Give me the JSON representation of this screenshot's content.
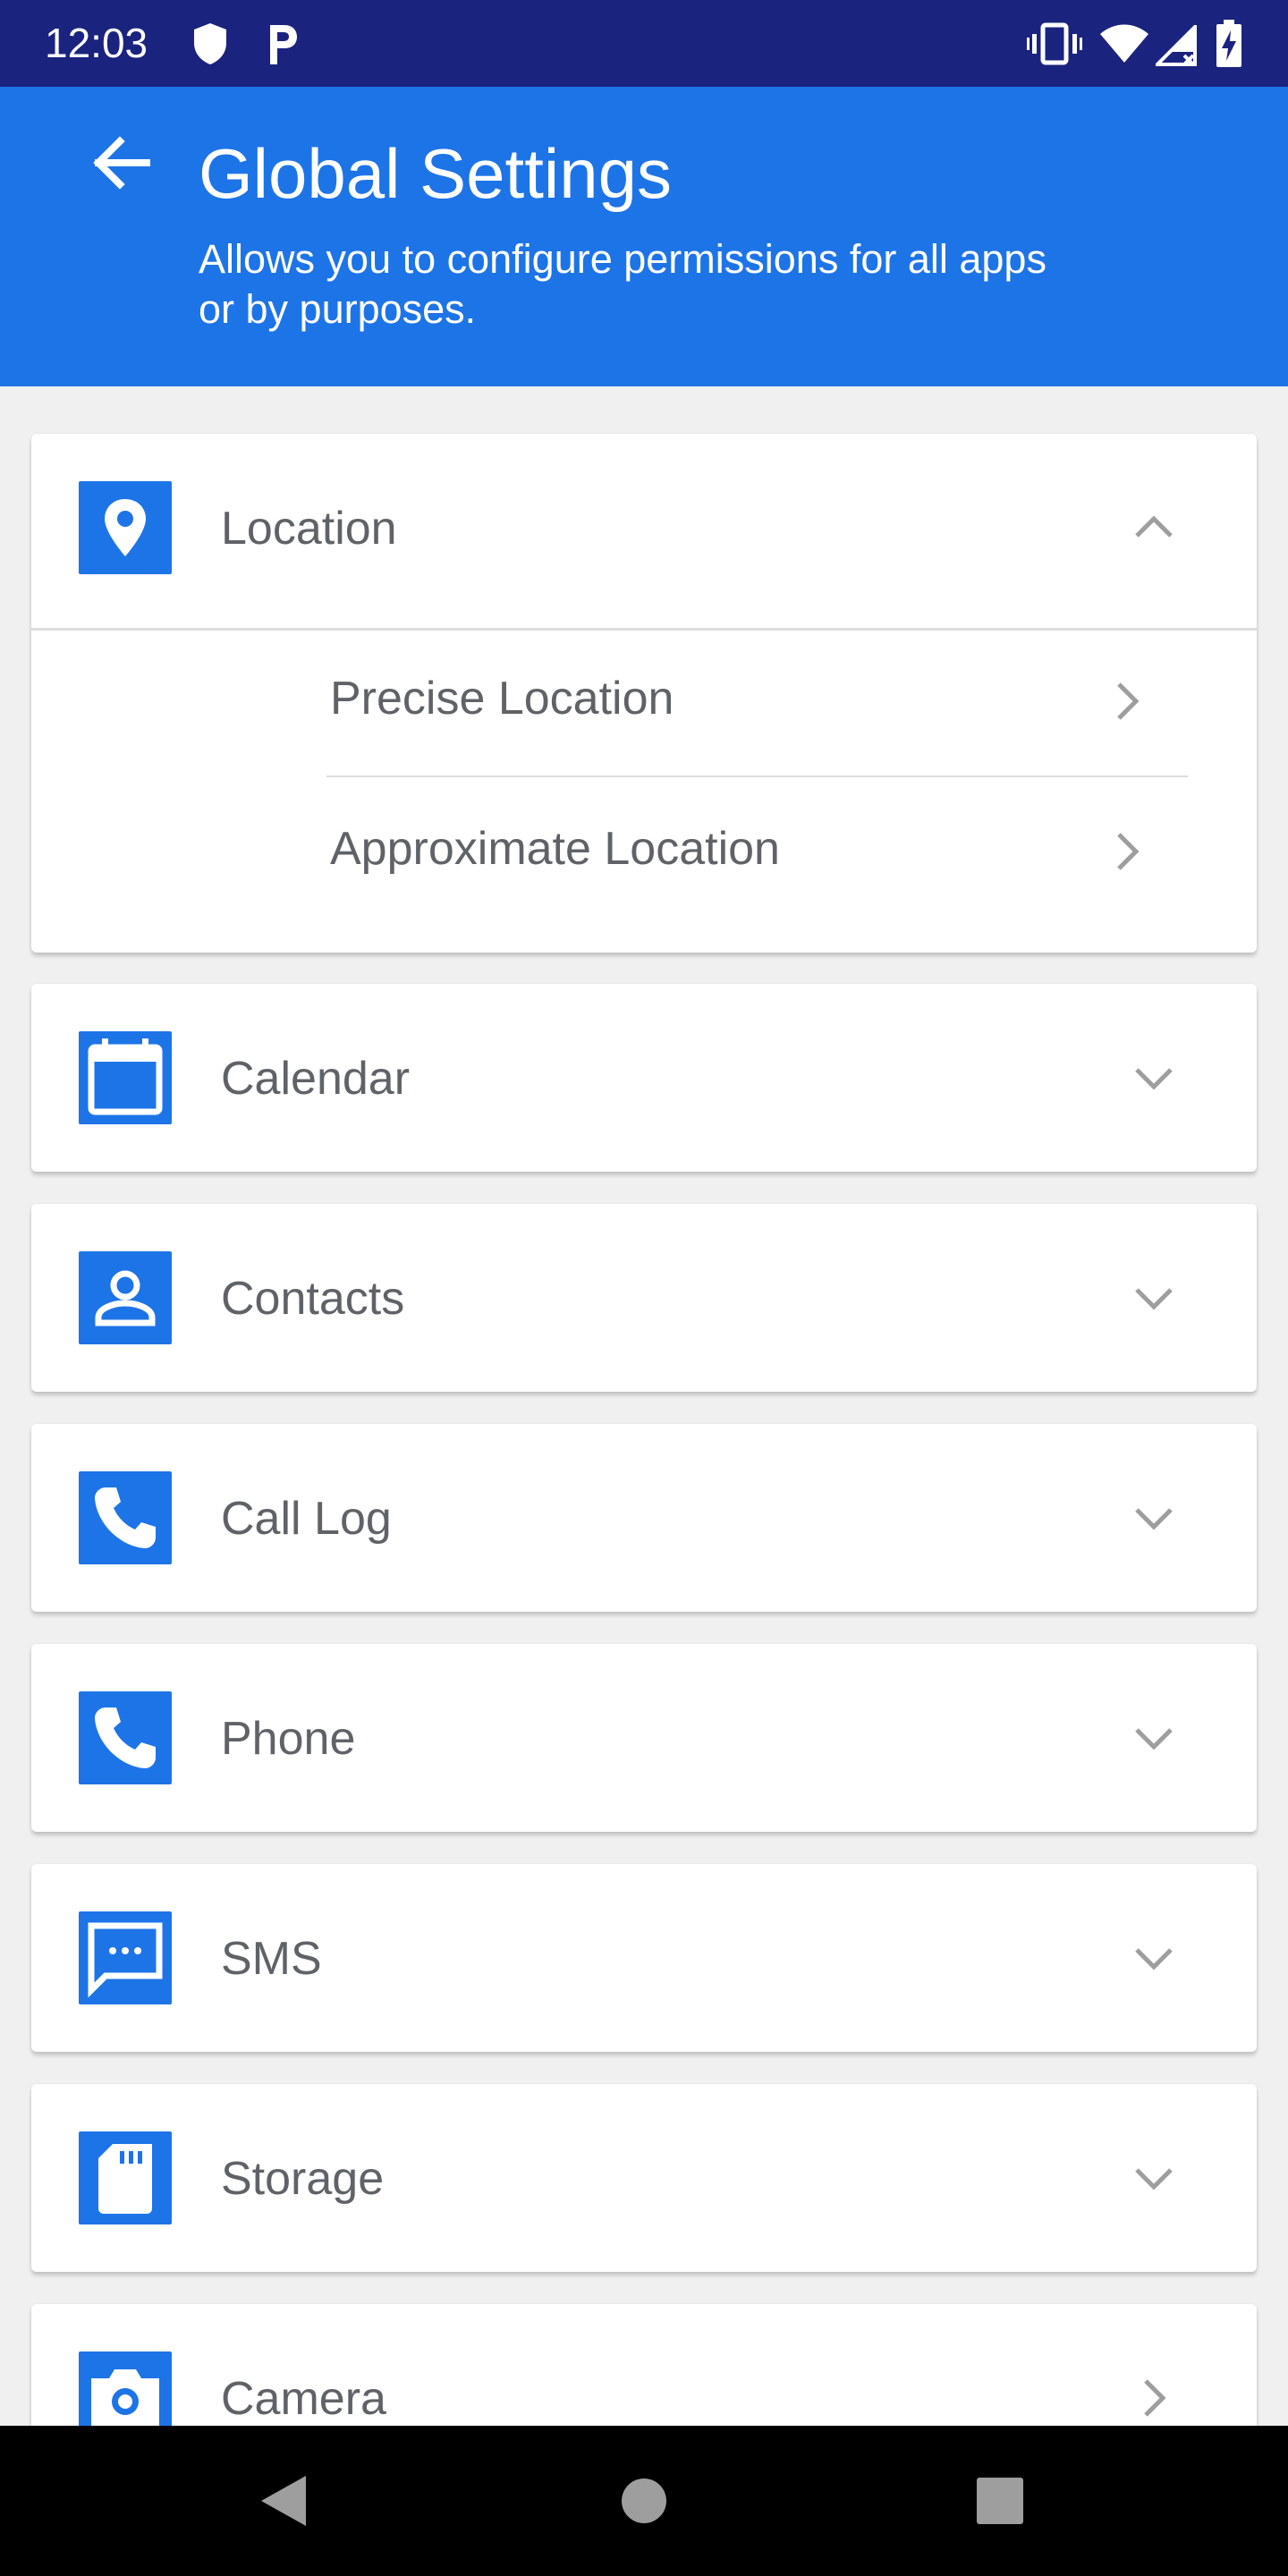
{
  "status_bar": {
    "time": "12:03",
    "left_icons": [
      "shield-icon",
      "parking-icon"
    ],
    "right_icons": [
      "vibrate-icon",
      "wifi-icon",
      "signal-icon",
      "battery-charging-icon"
    ],
    "background": "#1a237e"
  },
  "app_bar": {
    "title": "Global Settings",
    "subtitle": "Allows you to configure permissions for all apps or by purposes.",
    "back_icon": "arrow-left-icon",
    "background": "#1d74e7"
  },
  "permissions": [
    {
      "label": "Location",
      "icon": "location-pin-icon",
      "expanded": true,
      "children": [
        {
          "label": "Precise Location"
        },
        {
          "label": "Approximate Location"
        }
      ]
    },
    {
      "label": "Calendar",
      "icon": "calendar-icon",
      "expanded": false
    },
    {
      "label": "Contacts",
      "icon": "contact-icon",
      "expanded": false
    },
    {
      "label": "Call Log",
      "icon": "phone-icon",
      "expanded": false
    },
    {
      "label": "Phone",
      "icon": "phone-icon",
      "expanded": false
    },
    {
      "label": "SMS",
      "icon": "message-icon",
      "expanded": false
    },
    {
      "label": "Storage",
      "icon": "sd-card-icon",
      "expanded": false
    },
    {
      "label": "Camera",
      "icon": "camera-icon",
      "expanded": false
    }
  ],
  "colors": {
    "accent": "#1d74e7",
    "label_text": "#5f6368",
    "chevron": "#9e9e9e"
  },
  "nav_bar": {
    "icons": [
      "back-triangle-icon",
      "home-circle-icon",
      "recents-square-icon"
    ]
  }
}
